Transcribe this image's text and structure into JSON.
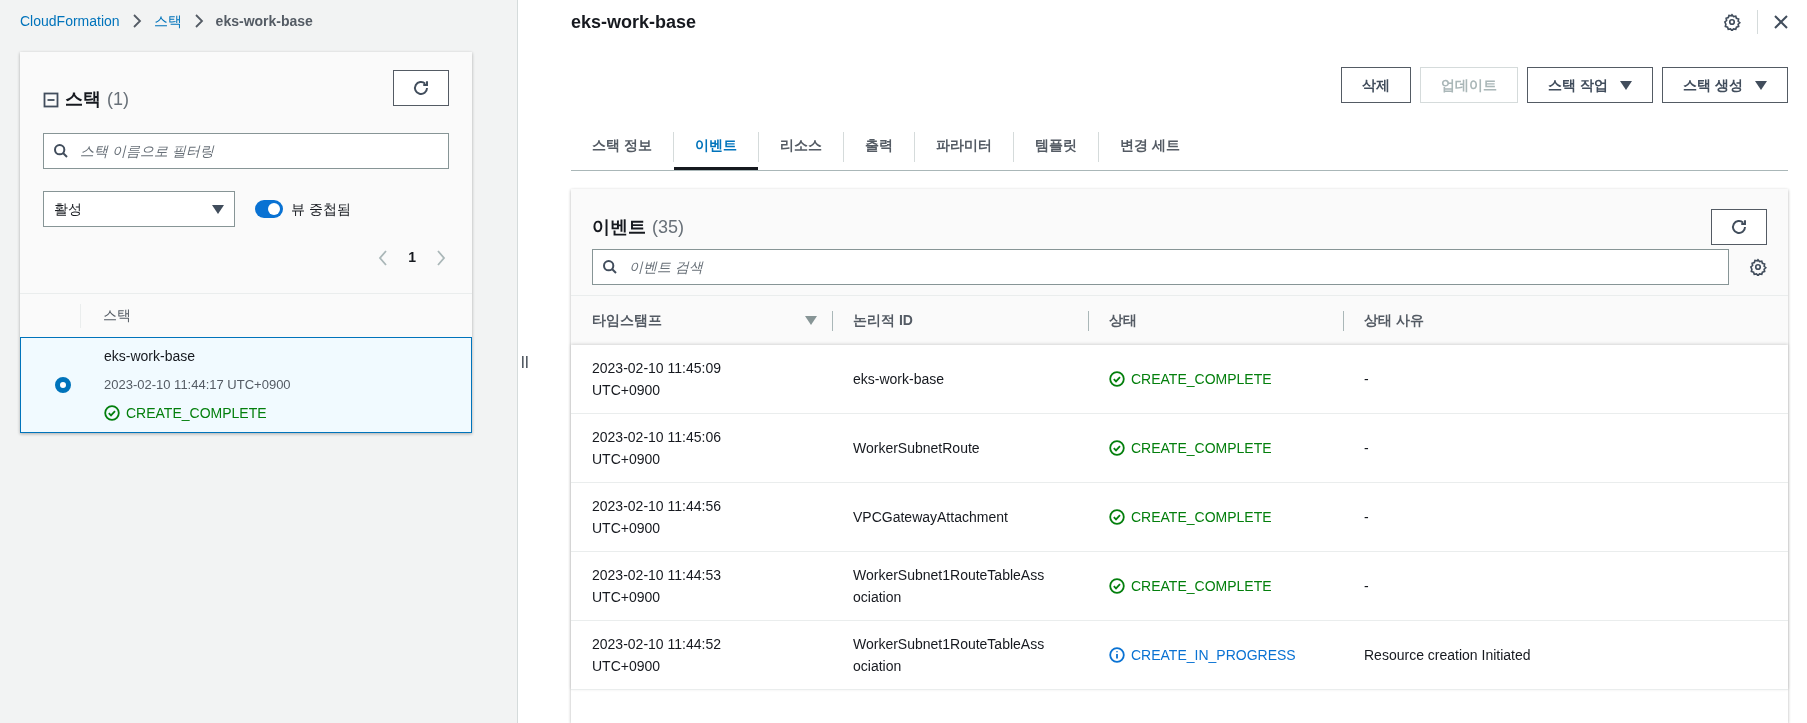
{
  "breadcrumb": [
    {
      "label": "CloudFormation",
      "link": true
    },
    {
      "label": "스택",
      "link": true
    },
    {
      "label": "eks-work-base",
      "link": false
    }
  ],
  "stacks_panel": {
    "title": "스택",
    "count": "(1)",
    "search": {
      "placeholder": "스택 이름으로 필터링"
    },
    "filter": {
      "value": "활성"
    },
    "toggle": {
      "label": "뷰 중첩됨",
      "on": true
    },
    "page": "1",
    "column": "스택",
    "rows": [
      {
        "name": "eks-work-base",
        "time": "2023-02-10 11:44:17 UTC+0900",
        "status": "CREATE_COMPLETE",
        "kind": "complete",
        "selected": true
      }
    ]
  },
  "detail": {
    "title": "eks-work-base",
    "buttons": [
      {
        "label": "삭제",
        "dropdown": false,
        "disabled": false
      },
      {
        "label": "업데이트",
        "dropdown": false,
        "disabled": true
      },
      {
        "label": "스택 작업",
        "dropdown": true,
        "disabled": false
      },
      {
        "label": "스택 생성",
        "dropdown": true,
        "disabled": false
      }
    ],
    "tabs": [
      {
        "label": "스택 정보",
        "selected": false
      },
      {
        "label": "이벤트",
        "selected": true
      },
      {
        "label": "리소스",
        "selected": false
      },
      {
        "label": "출력",
        "selected": false
      },
      {
        "label": "파라미터",
        "selected": false
      },
      {
        "label": "템플릿",
        "selected": false
      },
      {
        "label": "변경 세트",
        "selected": false
      }
    ],
    "events": {
      "title": "이벤트",
      "count": "(35)",
      "search": {
        "placeholder": "이벤트 검색"
      },
      "columns": [
        {
          "label": "타임스탬프",
          "sorted": true
        },
        {
          "label": "논리적 ID",
          "sorted": false
        },
        {
          "label": "상태",
          "sorted": false
        },
        {
          "label": "상태 사유",
          "sorted": false
        }
      ],
      "rows": [
        {
          "timestamp": "2023-02-10 11:45:09 UTC+0900",
          "logical_id": "eks-work-base",
          "status": "CREATE_COMPLETE",
          "kind": "complete",
          "reason": "-"
        },
        {
          "timestamp": "2023-02-10 11:45:06 UTC+0900",
          "logical_id": "WorkerSubnetRoute",
          "status": "CREATE_COMPLETE",
          "kind": "complete",
          "reason": "-"
        },
        {
          "timestamp": "2023-02-10 11:44:56 UTC+0900",
          "logical_id": "VPCGatewayAttachment",
          "status": "CREATE_COMPLETE",
          "kind": "complete",
          "reason": "-"
        },
        {
          "timestamp": "2023-02-10 11:44:53 UTC+0900",
          "logical_id": "WorkerSubnet1RouteTableAssociation",
          "status": "CREATE_COMPLETE",
          "kind": "complete",
          "reason": "-"
        },
        {
          "timestamp": "2023-02-10 11:44:52 UTC+0900",
          "logical_id": "WorkerSubnet1RouteTableAssociation",
          "status": "CREATE_IN_PROGRESS",
          "kind": "in_progress",
          "reason": "Resource creation Initiated"
        }
      ]
    }
  }
}
